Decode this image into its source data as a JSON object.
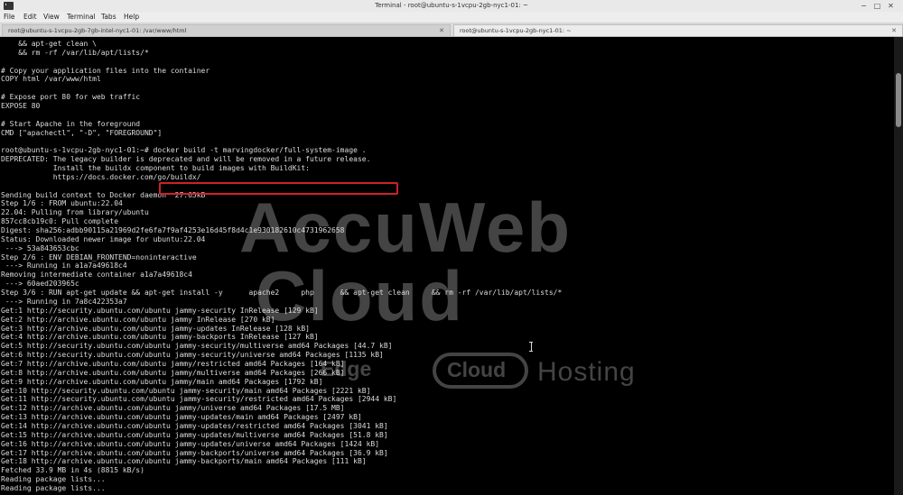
{
  "window": {
    "title": "Terminal - root@ubuntu-s-1vcpu-2gb-nyc1-01: ~",
    "controls": {
      "minimize": "−",
      "maximize": "□",
      "close": "✕"
    }
  },
  "menu": {
    "items": [
      "File",
      "Edit",
      "View",
      "Terminal",
      "Tabs",
      "Help"
    ]
  },
  "tabs": [
    {
      "label": "root@ubuntu-s-1vcpu-2gb-7gb-intel-nyc1-01: /var/www/html",
      "close": "✕"
    },
    {
      "label": "root@ubuntu-s-1vcpu-2gb-nyc1-01: ~",
      "close": "✕"
    }
  ],
  "terminal": {
    "lines": [
      "    && apt-get clean \\",
      "    && rm -rf /var/lib/apt/lists/*",
      "",
      "# Copy your application files into the container",
      "COPY html /var/www/html",
      "",
      "# Expose port 80 for web traffic",
      "EXPOSE 80",
      "",
      "# Start Apache in the foreground",
      "CMD [\"apachectl\", \"-D\", \"FOREGROUND\"]",
      "",
      "root@ubuntu-s-1vcpu-2gb-nyc1-01:~# docker build -t marvingdocker/full-system-image .",
      "DEPRECATED: The legacy builder is deprecated and will be removed in a future release.",
      "            Install the buildx component to build images with BuildKit:",
      "            https://docs.docker.com/go/buildx/",
      "",
      "Sending build context to Docker daemon  27.65kB",
      "Step 1/6 : FROM ubuntu:22.04",
      "22.04: Pulling from library/ubuntu",
      "857cc8cb19c0: Pull complete",
      "Digest: sha256:adbb90115a21969d2fe6fa7f9af4253e16d45f8d4c1e930182610c4731962658",
      "Status: Downloaded newer image for ubuntu:22.04",
      " ---> 53a843653cbc",
      "Step 2/6 : ENV DEBIAN_FRONTEND=noninteractive",
      " ---> Running in a1a7a49618c4",
      "Removing intermediate container a1a7a49618c4",
      " ---> 60aed203965c",
      "Step 3/6 : RUN apt-get update && apt-get install -y      apache2     php      && apt-get clean     && rm -rf /var/lib/apt/lists/*",
      " ---> Running in 7a8c422353a7",
      "Get:1 http://security.ubuntu.com/ubuntu jammy-security InRelease [129 kB]",
      "Get:2 http://archive.ubuntu.com/ubuntu jammy InRelease [270 kB]",
      "Get:3 http://archive.ubuntu.com/ubuntu jammy-updates InRelease [128 kB]",
      "Get:4 http://archive.ubuntu.com/ubuntu jammy-backports InRelease [127 kB]",
      "Get:5 http://security.ubuntu.com/ubuntu jammy-security/multiverse amd64 Packages [44.7 kB]",
      "Get:6 http://security.ubuntu.com/ubuntu jammy-security/universe amd64 Packages [1135 kB]",
      "Get:7 http://archive.ubuntu.com/ubuntu jammy/restricted amd64 Packages [164 kB]",
      "Get:8 http://archive.ubuntu.com/ubuntu jammy/multiverse amd64 Packages [266 kB]",
      "Get:9 http://archive.ubuntu.com/ubuntu jammy/main amd64 Packages [1792 kB]",
      "Get:10 http://security.ubuntu.com/ubuntu jammy-security/main amd64 Packages [2221 kB]",
      "Get:11 http://security.ubuntu.com/ubuntu jammy-security/restricted amd64 Packages [2944 kB]",
      "Get:12 http://archive.ubuntu.com/ubuntu jammy/universe amd64 Packages [17.5 MB]",
      "Get:13 http://archive.ubuntu.com/ubuntu jammy-updates/main amd64 Packages [2497 kB]",
      "Get:14 http://archive.ubuntu.com/ubuntu jammy-updates/restricted amd64 Packages [3041 kB]",
      "Get:15 http://archive.ubuntu.com/ubuntu jammy-updates/multiverse amd64 Packages [51.8 kB]",
      "Get:16 http://archive.ubuntu.com/ubuntu jammy-updates/universe amd64 Packages [1424 kB]",
      "Get:17 http://archive.ubuntu.com/ubuntu jammy-backports/universe amd64 Packages [36.9 kB]",
      "Get:18 http://archive.ubuntu.com/ubuntu jammy-backports/main amd64 Packages [111 kB]",
      "Fetched 33.9 MB in 4s (8815 kB/s)",
      "Reading package lists...",
      "Reading package lists..."
    ]
  },
  "watermark": {
    "line1": "AccuWeb",
    "line2": "Cloud",
    "tagline": "Edge",
    "badge": "Cloud",
    "tail": "Hosting"
  },
  "colors": {
    "highlight": "#d0202a",
    "terminal_bg": "#000000",
    "terminal_fg": "#dcdcdc"
  }
}
